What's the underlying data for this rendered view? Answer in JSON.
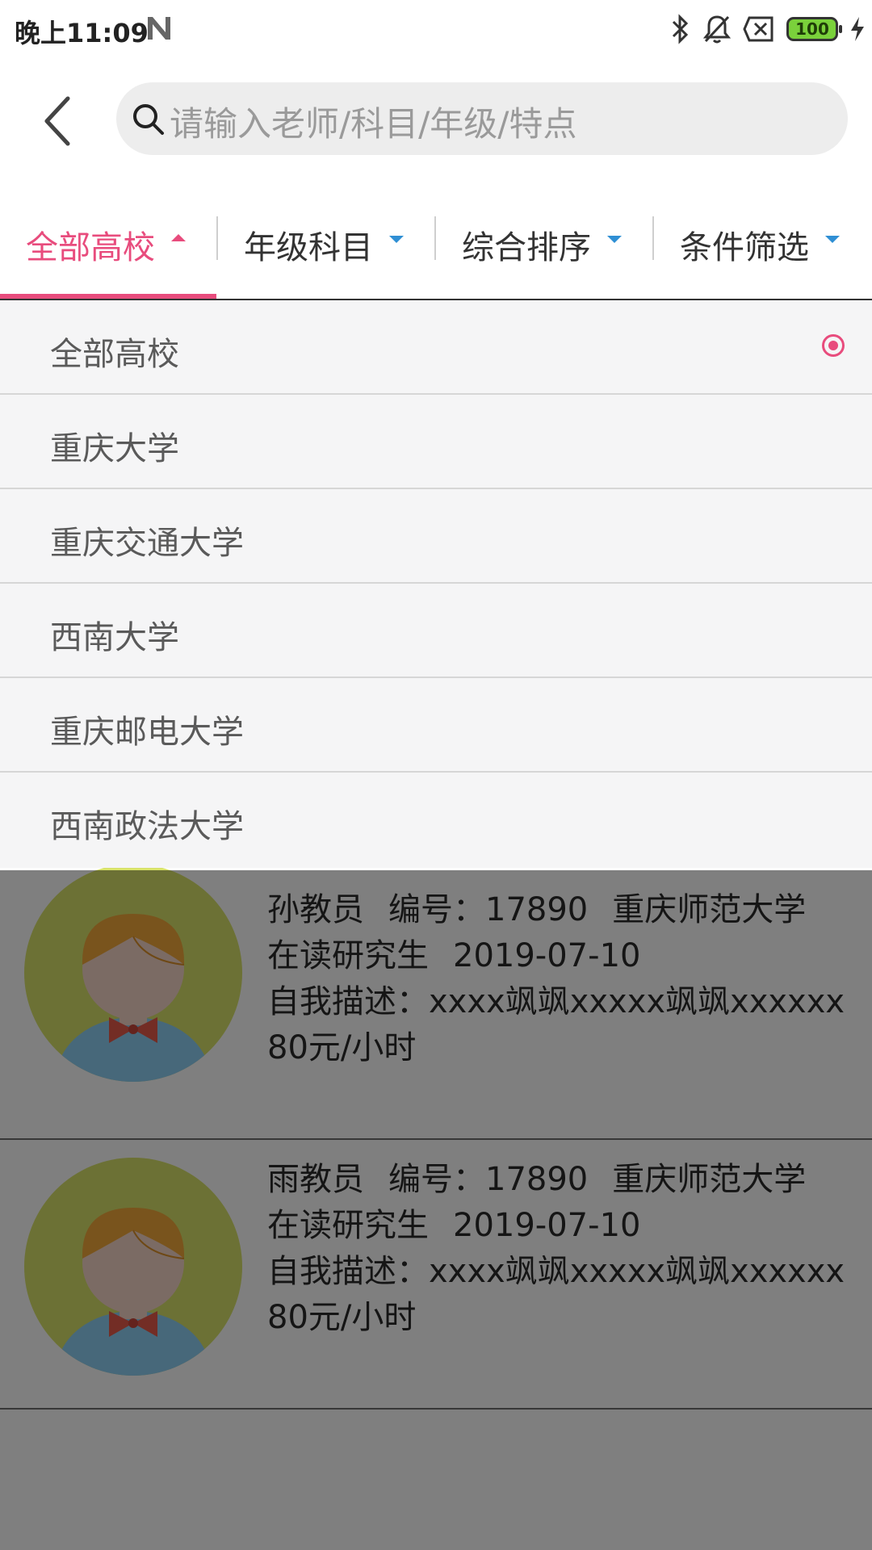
{
  "status_bar": {
    "time": "晚上11:09",
    "battery": "100"
  },
  "search": {
    "placeholder": "请输入老师/科目/年级/特点"
  },
  "tabs": [
    {
      "label": "全部高校",
      "active": true
    },
    {
      "label": "年级科目",
      "active": false
    },
    {
      "label": "综合排序",
      "active": false
    },
    {
      "label": "条件筛选",
      "active": false
    }
  ],
  "dropdown": {
    "items": [
      {
        "label": "全部高校",
        "selected": true
      },
      {
        "label": "重庆大学",
        "selected": false
      },
      {
        "label": "重庆交通大学",
        "selected": false
      },
      {
        "label": "西南大学",
        "selected": false
      },
      {
        "label": "重庆邮电大学",
        "selected": false
      },
      {
        "label": "西南政法大学",
        "selected": false
      }
    ]
  },
  "teachers": [
    {
      "name": "孙教员",
      "number": "编号：17890",
      "school": "重庆师范大学",
      "status": "在读研究生",
      "date": "2019-07-10",
      "description": "自我描述：xxxx飒飒xxxxx飒飒xxxxxx",
      "price": "80元/小时"
    },
    {
      "name": "雨教员",
      "number": "编号：17890",
      "school": "重庆师范大学",
      "status": "在读研究生",
      "date": "2019-07-10",
      "description": "自我描述：xxxx飒飒xxxxx飒飒xxxxxx",
      "price": "80元/小时"
    }
  ],
  "colors": {
    "accent": "#e84c7d",
    "arrow": "#2f8fd4",
    "avatar_bg": "#d9e36a"
  }
}
